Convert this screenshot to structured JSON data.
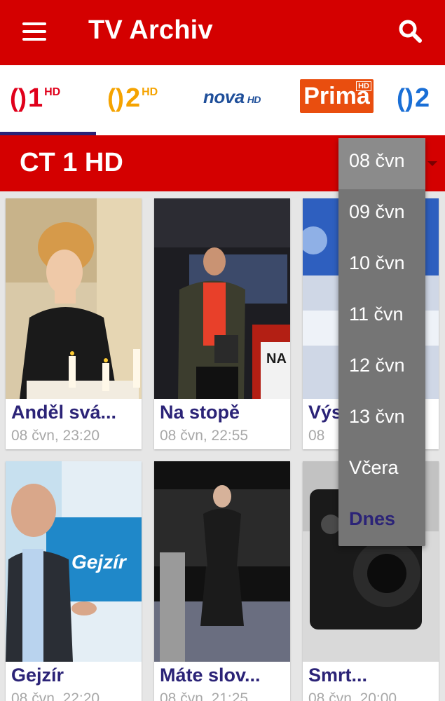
{
  "header": {
    "title": "TV Archiv",
    "menu_icon": "hamburger-menu-icon",
    "search_icon": "search-icon"
  },
  "channels": [
    {
      "label": "1",
      "hd": "HD",
      "color": "#e0001b"
    },
    {
      "label": "2",
      "hd": "HD",
      "color": "#f5a300"
    },
    {
      "label": "nova",
      "hd": "HD",
      "color": "#1f4f9a"
    },
    {
      "label": "Prima",
      "hd": "HD",
      "color": "#e94e0f"
    },
    {
      "label": "2",
      "hd": "",
      "color": "#1a6fd6"
    }
  ],
  "channel_header": {
    "name": "CT 1 HD"
  },
  "programs": [
    {
      "title": "Anděl svá...",
      "time": "08 čvn, 23:20"
    },
    {
      "title": "Na stopě",
      "time": "08 čvn, 22:55"
    },
    {
      "title": "Výs",
      "time": "08 "
    },
    {
      "title": "Gejzír",
      "time": "08 čvn, 22:20"
    },
    {
      "title": "Máte slov...",
      "time": "08 čvn, 21:25"
    },
    {
      "title": "Smrt...",
      "time": "08 čvn, 20:00"
    }
  ],
  "gejzir_logo": "Gejzír",
  "nav_badge": "NA",
  "date_menu": {
    "items": [
      "08 čvn",
      "09 čvn",
      "10 čvn",
      "11 čvn",
      "12 čvn",
      "13 čvn",
      "Včera",
      "Dnes"
    ],
    "selected": "08 čvn"
  },
  "colors": {
    "brand_red": "#d40000",
    "accent_indigo": "#2b2377",
    "menu_gray": "#757575"
  }
}
